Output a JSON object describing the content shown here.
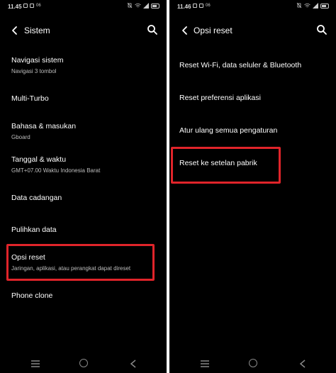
{
  "colors": {
    "background": "#000000",
    "highlight": "#e0242a",
    "text": "#ffffff",
    "subtext": "#bdbdbd"
  },
  "left": {
    "status": {
      "time": "11.45",
      "signal_text": "06"
    },
    "appbar": {
      "title": "Sistem",
      "back_icon": "arrow-back-icon",
      "search_icon": "search-icon"
    },
    "items": [
      {
        "title": "Navigasi sistem",
        "subtitle": "Navigasi 3 tombol"
      },
      {
        "title": "Multi-Turbo"
      },
      {
        "title": "Bahasa & masukan",
        "subtitle": "Gboard"
      },
      {
        "title": "Tanggal & waktu",
        "subtitle": "GMT+07.00 Waktu Indonesia Barat"
      },
      {
        "title": "Data cadangan"
      },
      {
        "title": "Pulihkan data"
      },
      {
        "title": "Opsi reset",
        "subtitle": "Jaringan, aplikasi, atau perangkat dapat direset",
        "highlighted": true
      },
      {
        "title": "Phone clone"
      }
    ]
  },
  "right": {
    "status": {
      "time": "11.46",
      "signal_text": "06"
    },
    "appbar": {
      "title": "Opsi reset",
      "back_icon": "arrow-back-icon",
      "search_icon": "search-icon"
    },
    "items": [
      {
        "title": "Reset Wi-Fi, data seluler & Bluetooth"
      },
      {
        "title": "Reset preferensi aplikasi"
      },
      {
        "title": "Atur ulang semua pengaturan"
      },
      {
        "title": "Reset ke setelan pabrik",
        "highlighted": true
      }
    ]
  }
}
